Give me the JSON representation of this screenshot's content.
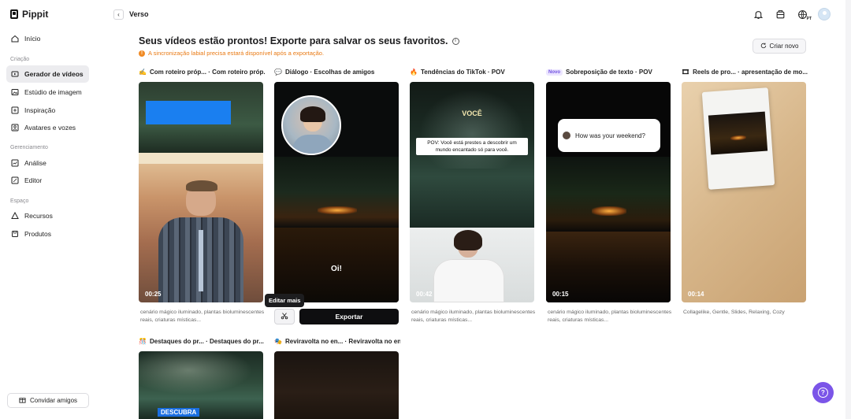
{
  "app": {
    "name": "Pippit"
  },
  "sidebar": {
    "items": [
      {
        "label": "Início",
        "icon": "home-icon"
      },
      {
        "label": "Gerador de vídeos",
        "icon": "video-generator-icon",
        "active": true
      },
      {
        "label": "Estúdio de imagem",
        "icon": "image-studio-icon"
      },
      {
        "label": "Inspiração",
        "icon": "inspiration-icon"
      },
      {
        "label": "Avatares e vozes",
        "icon": "avatar-voice-icon"
      },
      {
        "label": "Análise",
        "icon": "analytics-icon"
      },
      {
        "label": "Editor",
        "icon": "editor-icon"
      },
      {
        "label": "Recursos",
        "icon": "assets-icon"
      },
      {
        "label": "Produtos",
        "icon": "products-icon"
      }
    ],
    "sections": {
      "creation": "Criação",
      "management": "Gerenciamento",
      "space": "Espaço"
    },
    "invite_label": "Convidar amigos"
  },
  "topbar": {
    "breadcrumb": "Verso",
    "language_badge": "PT"
  },
  "main": {
    "headline": "Seus vídeos estão prontos! Exporte para salvar os seus favoritos.",
    "warning": "A sincronização labial precisa estará disponível após a exportação.",
    "create_new_label": "Criar novo",
    "cards": [
      {
        "title": "Com roteiro próp... · Com roteiro próp...",
        "emoji": "✍",
        "duration": "00:25",
        "desc": "cenário mágico iluminado, plantas bioluminescentes reais, criaturas místicas..."
      },
      {
        "title": "Diálogo · Escolhas de amigos",
        "emoji": "💬",
        "caption": "Oi!"
      },
      {
        "title": "Tendências do TikTok · POV",
        "emoji": "🔥",
        "duration": "00:42",
        "overlay_top": "Você",
        "overlay_text": "POV: Você está prestes a descobrir um mundo encantado só para você.",
        "desc": "cenário mágico iluminado, plantas bioluminescentes reais, criaturas místicas..."
      },
      {
        "title": "Sobreposição de texto · POV",
        "badge": "Novo",
        "duration": "00:15",
        "bubble": "How was your weekend?",
        "desc": "cenário mágico iluminado, plantas bioluminescentes reais, criaturas místicas..."
      },
      {
        "title": "Reels de pro... · apresentação de mo...",
        "emoji": "🎞",
        "duration": "00:14",
        "desc": "Collagelike, Gentle, Slides, Relaxing, Cozy"
      },
      {
        "title": "Destaques do pr... · Destaques do pr...",
        "emoji": "🎊",
        "overlay_text": "DESCUBRA"
      },
      {
        "title": "Reviravolta no en... · Reviravolta no en...",
        "emoji": "🎭"
      }
    ],
    "tooltip": "Editar mais",
    "export_label": "Exportar"
  },
  "colors": {
    "accent": "#7b55e8",
    "warning": "#e97a14",
    "export_bg": "#0e0e10",
    "highlight_blue": "#1a7ff0"
  }
}
